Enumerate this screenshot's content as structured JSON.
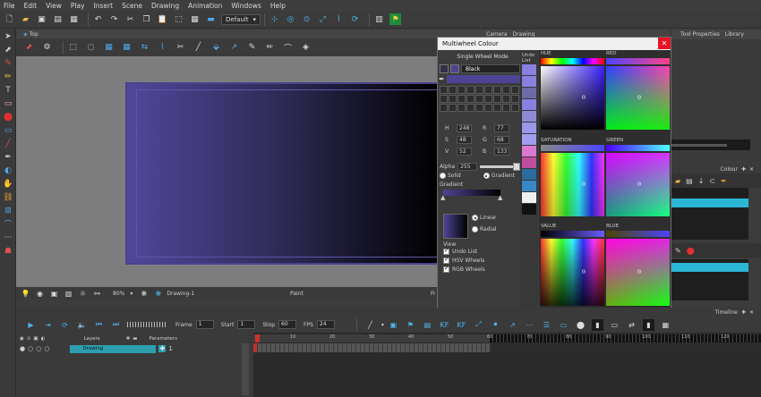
{
  "menu": [
    "File",
    "Edit",
    "View",
    "Play",
    "Insert",
    "Scene",
    "Drawing",
    "Animation",
    "Windows",
    "Help"
  ],
  "toolbar": {
    "workspace": "Default"
  },
  "camera_view": {
    "tab": "Top",
    "zoom": "80%",
    "drawing": "Drawing-1",
    "tool": "Paint",
    "frame_label": "Fr"
  },
  "right_tabs": {
    "camera": "Camera",
    "drawing": "Drawing",
    "tool_properties": "Tool Properties",
    "library": "Library"
  },
  "colour_panel": {
    "title": "Colour"
  },
  "dialog": {
    "title": "Multiwheel Colour",
    "close": "✕",
    "mode": "Single Wheel Mode",
    "colour_name": "Black",
    "undo_list_label": "Undo List",
    "hsv": [
      {
        "label": "H",
        "value": "248"
      },
      {
        "label": "S",
        "value": "48"
      },
      {
        "label": "V",
        "value": "52"
      }
    ],
    "rgb": [
      {
        "label": "R",
        "value": "77"
      },
      {
        "label": "G",
        "value": "68"
      },
      {
        "label": "B",
        "value": "133"
      }
    ],
    "alpha_label": "Alpha",
    "alpha_value": "255",
    "solid": "Solid",
    "gradient": "Gradient",
    "gradient_label": "Gradient",
    "linear": "Linear",
    "radial": "Radial",
    "view_label": "View",
    "undo_list_check": "Undo List",
    "hsv_wheels": "HSV Wheels",
    "rgb_wheels": "RGB Wheels",
    "wheels": {
      "hue": "HUE",
      "red": "RED",
      "saturation": "SATURATION",
      "green": "GREEN",
      "value": "VALUE",
      "blue": "BLUE"
    },
    "undo_colours": [
      "#8a80e0",
      "#8a80e0",
      "#6d6aa8",
      "#8a80e0",
      "#8e8ad8",
      "#9a98e8",
      "#a09ef0",
      "#d97ad0",
      "#c04da0",
      "#2b6ca0",
      "#3a87c8",
      "#f0f0f0",
      "#111111"
    ]
  },
  "timeline": {
    "title": "Timeline",
    "frame_label": "Frame",
    "frame": "1",
    "start_label": "Start",
    "start": "1",
    "stop_label": "Stop",
    "stop": "60",
    "fps_label": "FPS",
    "fps": "24",
    "layers_label": "Layers",
    "parameters_label": "Parameters",
    "layer_name": "Drawing",
    "layer_frame": "1",
    "ruler_ticks": [
      "10",
      "20",
      "30",
      "40",
      "50",
      "60",
      "70",
      "80",
      "90",
      "100",
      "110",
      "120"
    ]
  }
}
